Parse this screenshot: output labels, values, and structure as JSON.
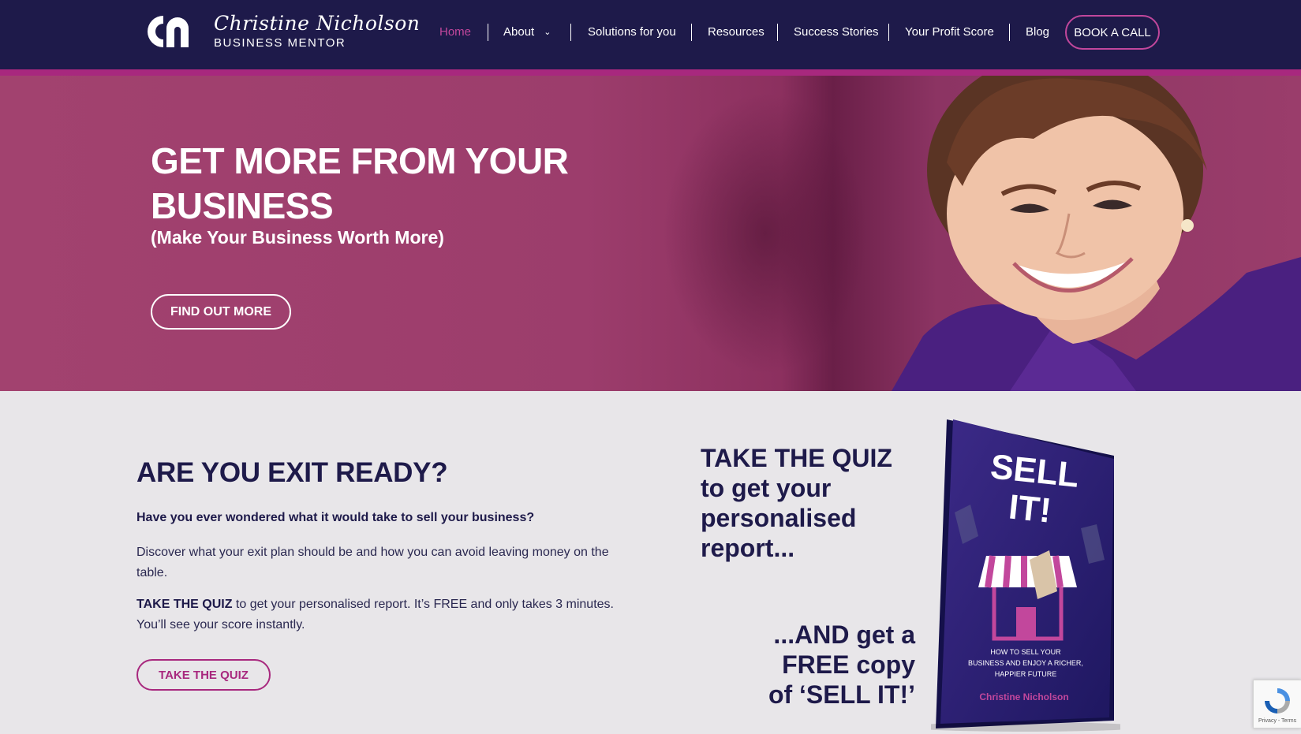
{
  "brand": {
    "name": "Christine Nicholson",
    "tagline": "BUSINESS MENTOR"
  },
  "nav": {
    "items": [
      {
        "label": "Home",
        "active": true
      },
      {
        "label": "About",
        "has_dropdown": true
      },
      {
        "label": "Solutions for you"
      },
      {
        "label": "Resources"
      },
      {
        "label": "Success Stories"
      },
      {
        "label": "Your Profit Score"
      },
      {
        "label": "Blog"
      }
    ],
    "cta": "BOOK A CALL"
  },
  "hero": {
    "title_line1": "GET MORE FROM YOUR",
    "title_line2": "BUSINESS",
    "subtitle": "(Make Your Business Worth More)",
    "button": "FIND OUT MORE"
  },
  "exit": {
    "title": "ARE YOU EXIT READY?",
    "question": "Have you ever wondered what it would take to sell your business?",
    "para1": "Discover what your exit plan should be and how you can avoid leaving money on the table.",
    "para2_bold": "TAKE THE QUIZ",
    "para2_rest": " to get your personalised report. It’s FREE and only takes 3 minutes. You’ll see your score instantly.",
    "button": "TAKE THE QUIZ"
  },
  "promo": {
    "line1": "TAKE THE QUIZ",
    "line2": "to get your",
    "line3": "personalised",
    "line4": "report...",
    "line5": "...AND get a",
    "line6": "FREE copy",
    "line7": "of ‘SELL IT!’"
  },
  "book": {
    "title_line1": "SELL",
    "title_line2": "IT!",
    "subtitle_line1": "HOW TO SELL YOUR",
    "subtitle_line2": "BUSINESS AND ENJOY A RICHER,",
    "subtitle_line3": "HAPPIER FUTURE",
    "author": "Christine Nicholson"
  },
  "recaptcha": {
    "links": "Privacy - Terms"
  },
  "colors": {
    "navy": "#1e1a4a",
    "magenta": "#a8287e",
    "pink_accent": "#c2479c",
    "hero_bg": "#9c3d6c",
    "page_bg": "#e8e6e9"
  }
}
